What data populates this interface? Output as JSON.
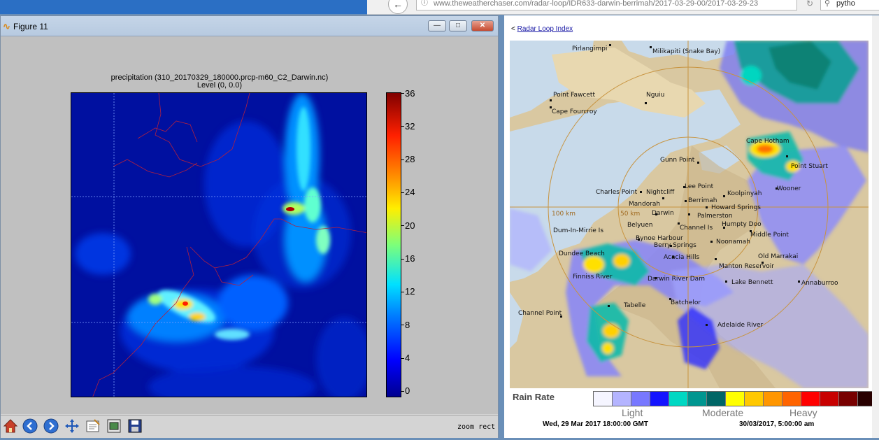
{
  "browser": {
    "url": "www.theweatherchaser.com/radar-loop/IDR633-darwin-berrimah/2017-03-29-00/2017-03-29-23",
    "search_text": "pytho"
  },
  "figure_window": {
    "title": "Figure 11",
    "plot_title_line1": "precipitation (310_20170329_180000.prcp-m60_C2_Darwin.nc)",
    "plot_title_line2": "Level  (0, 0.0)",
    "colorbar_ticks": [
      "36",
      "32",
      "28",
      "24",
      "20",
      "16",
      "12",
      "8",
      "4",
      "0"
    ],
    "toolbar_status": "zoom rect",
    "toolbar_icons": [
      "home-icon",
      "back-icon",
      "forward-icon",
      "pan-icon",
      "configure-icon",
      "subplots-icon",
      "save-icon"
    ]
  },
  "radar_page": {
    "link_prefix": "<",
    "link_text": "Radar Loop Index",
    "rain_rate_label": "Rain Rate",
    "legend_light": "Light",
    "legend_moderate": "Moderate",
    "legend_heavy": "Heavy",
    "legend_colors": [
      "#f5f5ff",
      "#b4b4ff",
      "#7878ff",
      "#1414ff",
      "#00d8c3",
      "#009690",
      "#006666",
      "#ffff00",
      "#ffc800",
      "#ff9600",
      "#ff6400",
      "#ff0000",
      "#c80000",
      "#780000",
      "#280000"
    ],
    "date_left": "Wed, 29 Mar 2017 18:00:00 GMT",
    "date_right": "30/03/2017, 5:00:00 am",
    "range_100": "100 km",
    "range_50": "50 km",
    "places": [
      "Pirlangimpi",
      "Milikapiti (Snake Bay)",
      "Point Fawcett",
      "Cape Fourcroy",
      "Nguiu",
      "Cape Hotham",
      "Point Stuart",
      "Gunn Point",
      "Lee Point",
      "Charles Point",
      "Nightcliff",
      "Koolpinyah",
      "Wooner",
      "Mandorah",
      "Berrimah",
      "Darwin",
      "Howard Springs",
      "Palmerston",
      "Belyuen",
      "Channel Is",
      "Humpty Doo",
      "Dum-In-Mirrie Is",
      "Middle Point",
      "Bynoe Harbour",
      "Berry Springs",
      "Noonamah",
      "Dundee Beach",
      "Acacia Hills",
      "Old Marrakai",
      "Manton Reservoir",
      "Finniss River",
      "Darwin River Dam",
      "Lake Bennett",
      "Annaburroo",
      "Tabelle",
      "Batchelor",
      "Channel Point",
      "Adelaide River"
    ]
  }
}
